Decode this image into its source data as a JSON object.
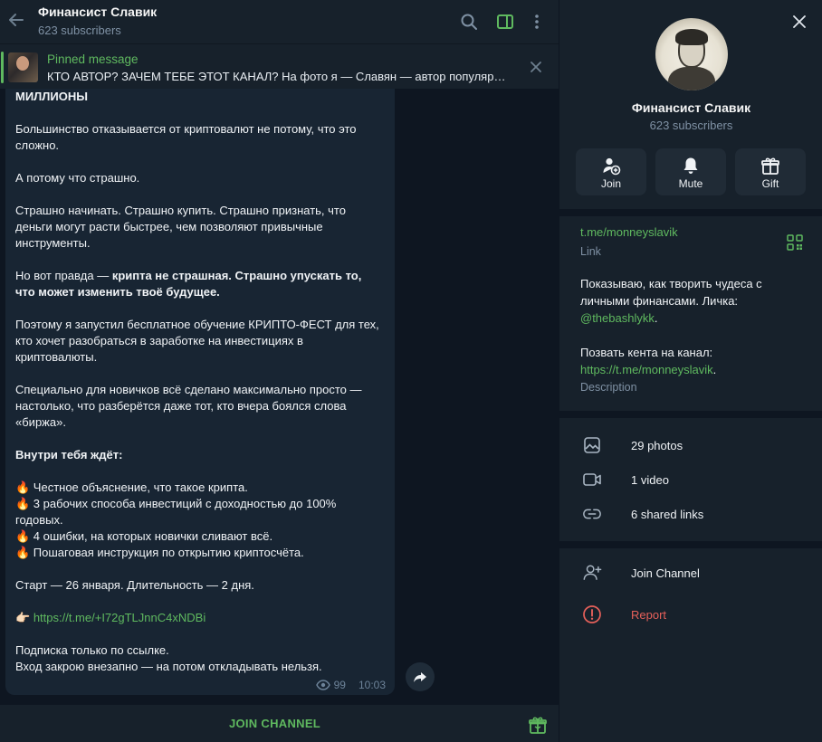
{
  "header": {
    "title": "Финансист Славик",
    "subscribers": "623 subscribers"
  },
  "pinned": {
    "title": "Pinned message",
    "text": "КТО АВТОР? ЗАЧЕМ ТЕБЕ ЭТОТ КАНАЛ?  На фото я — Славян — автор популярн..."
  },
  "message": {
    "lines": [
      {
        "b": "МИЛЛИОНЫ"
      },
      {
        "t": ""
      },
      {
        "t": "Большинство отказывается от криптовалют не потому, что это"
      },
      {
        "t": "сложно."
      },
      {
        "t": ""
      },
      {
        "t": "А потому что страшно."
      },
      {
        "t": ""
      },
      {
        "t": "Страшно начинать. Страшно купить. Страшно признать, что"
      },
      {
        "t": "деньги могут расти быстрее, чем позволяют привычные"
      },
      {
        "t": "инструменты."
      },
      {
        "t": ""
      },
      {
        "t": "Но вот правда — ",
        "b": "крипта не страшная. Страшно упускать то,"
      },
      {
        "b": "что может изменить твоё будущее."
      },
      {
        "t": ""
      },
      {
        "t": "Поэтому я запустил бесплатное обучение КРИПТО-ФЕСТ для тех,"
      },
      {
        "t": "кто хочет разобраться в заработке на инвестициях в"
      },
      {
        "t": "криптовалюты."
      },
      {
        "t": ""
      },
      {
        "t": "Специально для новичков всё сделано максимально просто —"
      },
      {
        "t": "настолько, что разберётся даже тот, кто вчера боялся слова"
      },
      {
        "t": "«биржа»."
      },
      {
        "t": ""
      },
      {
        "b": "Внутри тебя ждёт:"
      },
      {
        "t": ""
      },
      {
        "t": "🔥 Честное объяснение, что такое крипта."
      },
      {
        "t": "🔥 3 рабочих способа инвестиций с доходностью до 100%"
      },
      {
        "t": "годовых."
      },
      {
        "t": "🔥 4 ошибки, на которых новички сливают всё."
      },
      {
        "t": "🔥 Пошаговая инструкция по открытию криптосчёта."
      },
      {
        "t": ""
      },
      {
        "t": "Старт — 26 января. Длительность — 2 дня."
      },
      {
        "t": ""
      },
      {
        "t": "👉🏻 ",
        "link": "https://t.me/+I72gTLJnnC4xNDBi"
      },
      {
        "t": ""
      },
      {
        "t": "Подписка только по ссылке."
      },
      {
        "t": "Вход закрою внезапно — на потом откладывать нельзя."
      }
    ],
    "views": "99",
    "time": "10:03"
  },
  "bottom": {
    "join_label": "JOIN CHANNEL"
  },
  "panel": {
    "title": "Финансист Славик",
    "subscribers": "623 subscribers",
    "actions": [
      {
        "label": "Join",
        "icon": "add-user-icon"
      },
      {
        "label": "Mute",
        "icon": "bell-icon"
      },
      {
        "label": "Gift",
        "icon": "gift-icon"
      }
    ],
    "link": "t.me/monneyslavik",
    "link_label": "Link",
    "description_parts": {
      "line1": "Показываю, как творить чудеса с",
      "line2": "личными финансами. Личка:",
      "mention": "@thebashlykk",
      "dot": ".",
      "line4": "Позвать кента на канал:",
      "url": "https://t.me/monneyslavik",
      "dot2": "."
    },
    "description_label": "Description",
    "media": [
      {
        "label": "29 photos",
        "icon": "photo-icon"
      },
      {
        "label": "1 video",
        "icon": "video-icon"
      },
      {
        "label": "6 shared links",
        "icon": "link-icon"
      }
    ],
    "join_channel": "Join Channel",
    "report": "Report"
  },
  "colors": {
    "accent": "#5fb95f",
    "background": "#0e1621",
    "panel": "#17212b",
    "bubble": "#182533",
    "danger": "#e5605a"
  }
}
